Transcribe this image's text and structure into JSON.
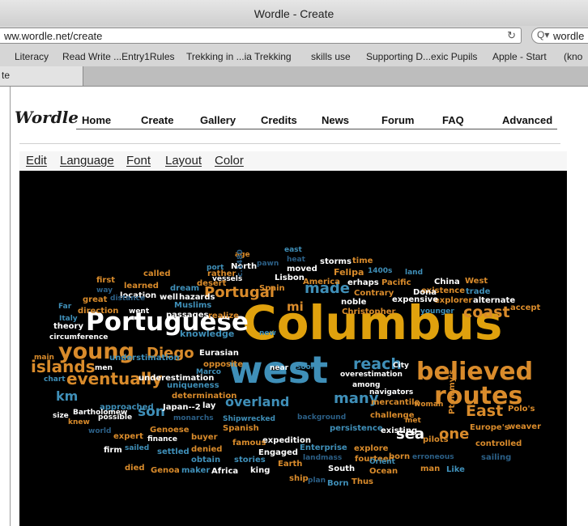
{
  "window": {
    "title": "Wordle - Create"
  },
  "address_bar": {
    "url": "ww.wordle.net/create",
    "reload_icon": "reload-icon"
  },
  "search_bar": {
    "text": "wordle",
    "icon": "search-icon"
  },
  "bookmarks": [
    "Literacy",
    "Read Write ...Entry1Rules",
    "Trekking in ...ia Trekking",
    "skills use",
    "Supporting D...exic Pupils",
    "Apple - Start",
    "(kno"
  ],
  "tab": {
    "label": "te"
  },
  "site": {
    "logo": "Wordle",
    "nav": [
      "Home",
      "Create",
      "Gallery",
      "Credits",
      "News",
      "Forum",
      "FAQ",
      "Advanced"
    ]
  },
  "editor_menu": [
    "Edit",
    "Language",
    "Font",
    "Layout",
    "Color"
  ],
  "colors": {
    "cloud_bg": "#000000",
    "orange": "#d98b2b",
    "gold": "#e0a10d",
    "blue": "#3f8fb8",
    "white": "#ffffff",
    "darkblue": "#2b5f86"
  },
  "cloud_words": [
    {
      "t": "Columbus",
      "c": "gold"
    },
    {
      "t": "west",
      "c": "blue"
    },
    {
      "t": "Portuguese",
      "c": "white"
    },
    {
      "t": "believed",
      "c": "orange"
    },
    {
      "t": "routes",
      "c": "orange"
    },
    {
      "t": "young",
      "c": "orange"
    },
    {
      "t": "eventually",
      "c": "orange"
    },
    {
      "t": "islands",
      "c": "orange"
    },
    {
      "t": "Diego",
      "c": "orange"
    },
    {
      "t": "Portugal",
      "c": "orange"
    },
    {
      "t": "made",
      "c": "blue"
    },
    {
      "t": "mi",
      "c": "orange"
    },
    {
      "t": "coast",
      "c": "orange"
    },
    {
      "t": "reach",
      "c": "blue"
    },
    {
      "t": "many",
      "c": "blue"
    },
    {
      "t": "overland",
      "c": "blue"
    },
    {
      "t": "sea",
      "c": "white"
    },
    {
      "t": "one",
      "c": "orange"
    },
    {
      "t": "East",
      "c": "orange"
    },
    {
      "t": "son",
      "c": "blue"
    },
    {
      "t": "km",
      "c": "blue"
    },
    {
      "t": "China",
      "c": "white"
    },
    {
      "t": "West",
      "c": "orange"
    },
    {
      "t": "trade",
      "c": "blue"
    },
    {
      "t": "existence",
      "c": "orange"
    },
    {
      "t": "explorer",
      "c": "orange"
    },
    {
      "t": "alternate",
      "c": "white"
    },
    {
      "t": "accept",
      "c": "orange"
    },
    {
      "t": "younger",
      "c": "blue"
    },
    {
      "t": "expensive",
      "c": "white"
    },
    {
      "t": "Dona",
      "c": "white"
    },
    {
      "t": "Contrary",
      "c": "orange"
    },
    {
      "t": "land",
      "c": "blue"
    },
    {
      "t": "Pacific",
      "c": "orange"
    },
    {
      "t": "erhaps",
      "c": "white"
    },
    {
      "t": "1400s",
      "c": "blue"
    },
    {
      "t": "Felipa",
      "c": "orange"
    },
    {
      "t": "time",
      "c": "orange"
    },
    {
      "t": "storms",
      "c": "white"
    },
    {
      "t": "moved",
      "c": "white"
    },
    {
      "t": "east",
      "c": "blue"
    },
    {
      "t": "heat",
      "c": "darkblue"
    },
    {
      "t": "pawn",
      "c": "darkblue"
    },
    {
      "t": "age",
      "c": "orange"
    },
    {
      "t": "North",
      "c": "white"
    },
    {
      "t": "c.1480",
      "c": "darkblue"
    },
    {
      "t": "Lisbon",
      "c": "white"
    },
    {
      "t": "America",
      "c": "orange"
    },
    {
      "t": "Spain",
      "c": "orange"
    },
    {
      "t": "noble",
      "c": "white"
    },
    {
      "t": "Christopher",
      "c": "orange"
    },
    {
      "t": "port",
      "c": "blue"
    },
    {
      "t": "rather",
      "c": "orange"
    },
    {
      "t": "vessels",
      "c": "white"
    },
    {
      "t": "called",
      "c": "orange"
    },
    {
      "t": "desert",
      "c": "orange"
    },
    {
      "t": "first",
      "c": "orange"
    },
    {
      "t": "learned",
      "c": "orange"
    },
    {
      "t": "dream",
      "c": "blue"
    },
    {
      "t": "way",
      "c": "darkblue"
    },
    {
      "t": "location",
      "c": "white"
    },
    {
      "t": "well",
      "c": "white"
    },
    {
      "t": "hazards",
      "c": "white"
    },
    {
      "t": "great",
      "c": "orange"
    },
    {
      "t": "distance",
      "c": "darkblue"
    },
    {
      "t": "Muslims",
      "c": "blue"
    },
    {
      "t": "Far",
      "c": "blue"
    },
    {
      "t": "direction",
      "c": "orange"
    },
    {
      "t": "went",
      "c": "white"
    },
    {
      "t": "passages",
      "c": "white"
    },
    {
      "t": "realize",
      "c": "orange"
    },
    {
      "t": "Italy",
      "c": "blue"
    },
    {
      "t": "theory",
      "c": "white"
    },
    {
      "t": "circumference",
      "c": "white"
    },
    {
      "t": "knowledge",
      "c": "blue"
    },
    {
      "t": "new",
      "c": "blue"
    },
    {
      "t": "main",
      "c": "orange"
    },
    {
      "t": "understimation",
      "c": "blue"
    },
    {
      "t": "Eurasian",
      "c": "white"
    },
    {
      "t": "men",
      "c": "white"
    },
    {
      "t": "opposite",
      "c": "orange"
    },
    {
      "t": "near",
      "c": "white"
    },
    {
      "t": "soon",
      "c": "blue"
    },
    {
      "t": "Marco",
      "c": "blue"
    },
    {
      "t": "chart",
      "c": "blue"
    },
    {
      "t": "underestimation",
      "c": "white"
    },
    {
      "t": "City",
      "c": "white"
    },
    {
      "t": "overestimation",
      "c": "white"
    },
    {
      "t": "among",
      "c": "white"
    },
    {
      "t": "navigators",
      "c": "white"
    },
    {
      "t": "uniqueness",
      "c": "blue"
    },
    {
      "t": "determination",
      "c": "orange"
    },
    {
      "t": "approached",
      "c": "blue"
    },
    {
      "t": "Japan--2",
      "c": "white"
    },
    {
      "t": "lay",
      "c": "white"
    },
    {
      "t": "mercantile",
      "c": "orange"
    },
    {
      "t": "woman",
      "c": "orange"
    },
    {
      "t": "Bartholomew",
      "c": "white"
    },
    {
      "t": "size",
      "c": "white"
    },
    {
      "t": "possible",
      "c": "white"
    },
    {
      "t": "knew",
      "c": "orange"
    },
    {
      "t": "monarchs",
      "c": "darkblue"
    },
    {
      "t": "Shipwrecked",
      "c": "blue"
    },
    {
      "t": "background",
      "c": "darkblue"
    },
    {
      "t": "challenge",
      "c": "orange"
    },
    {
      "t": "met",
      "c": "orange"
    },
    {
      "t": "Ptolemy's",
      "c": "orange"
    },
    {
      "t": "Polo's",
      "c": "orange"
    },
    {
      "t": "Genoese",
      "c": "orange"
    },
    {
      "t": "world",
      "c": "darkblue"
    },
    {
      "t": "expert",
      "c": "orange"
    },
    {
      "t": "finance",
      "c": "white"
    },
    {
      "t": "buyer",
      "c": "orange"
    },
    {
      "t": "Spanish",
      "c": "orange"
    },
    {
      "t": "expedition",
      "c": "white"
    },
    {
      "t": "persistence",
      "c": "blue"
    },
    {
      "t": "existing",
      "c": "white"
    },
    {
      "t": "pilots",
      "c": "orange"
    },
    {
      "t": "Europe's",
      "c": "orange"
    },
    {
      "t": "weaver",
      "c": "orange"
    },
    {
      "t": "firm",
      "c": "white"
    },
    {
      "t": "sailed",
      "c": "blue"
    },
    {
      "t": "settled",
      "c": "blue"
    },
    {
      "t": "denied",
      "c": "orange"
    },
    {
      "t": "famous",
      "c": "orange"
    },
    {
      "t": "Engaged",
      "c": "white"
    },
    {
      "t": "Enterprise",
      "c": "blue"
    },
    {
      "t": "explore",
      "c": "orange"
    },
    {
      "t": "controlled",
      "c": "orange"
    },
    {
      "t": "sailing",
      "c": "darkblue"
    },
    {
      "t": "obtain",
      "c": "blue"
    },
    {
      "t": "stories",
      "c": "blue"
    },
    {
      "t": "landmass",
      "c": "darkblue"
    },
    {
      "t": "fourteen",
      "c": "orange"
    },
    {
      "t": "erroneous",
      "c": "darkblue"
    },
    {
      "t": "died",
      "c": "orange"
    },
    {
      "t": "Genoa",
      "c": "orange"
    },
    {
      "t": "maker",
      "c": "blue"
    },
    {
      "t": "Africa",
      "c": "white"
    },
    {
      "t": "king",
      "c": "white"
    },
    {
      "t": "Earth",
      "c": "orange"
    },
    {
      "t": "South",
      "c": "white"
    },
    {
      "t": "Ocean",
      "c": "orange"
    },
    {
      "t": "man",
      "c": "orange"
    },
    {
      "t": "Like",
      "c": "blue"
    },
    {
      "t": "ship",
      "c": "orange"
    },
    {
      "t": "plan",
      "c": "darkblue"
    },
    {
      "t": "Born",
      "c": "blue"
    },
    {
      "t": "Thus",
      "c": "orange"
    },
    {
      "t": "Orient",
      "c": "blue"
    },
    {
      "t": "born",
      "c": "orange"
    }
  ]
}
